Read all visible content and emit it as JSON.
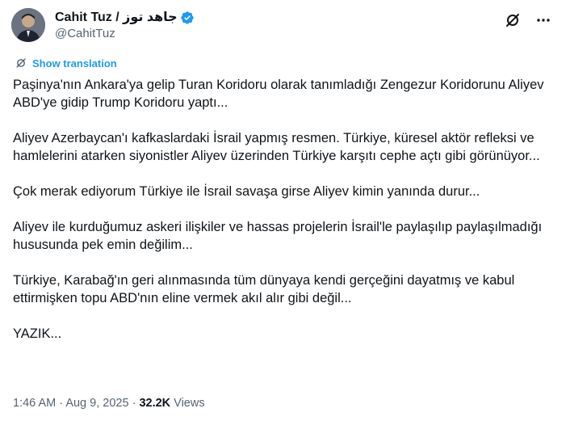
{
  "author": {
    "display_name": "Cahit Tuz / جاهد توز",
    "handle": "@CahitTuz",
    "verified": true
  },
  "translate": {
    "label": "Show translation"
  },
  "tweet": {
    "paragraphs": [
      "Paşinya'nın Ankara'ya gelip Turan Koridoru olarak tanımladığı Zengezur Koridorunu Aliyev ABD'ye gidip Trump Koridoru yaptı...",
      "Aliyev Azerbaycan'ı kafkaslardaki İsrail yapmış resmen. Türkiye, küresel aktör refleksi ve hamlelerini atarken siyonistler Aliyev üzerinden Türkiye karşıtı cephe açtı gibi görünüyor...",
      "Çok merak ediyorum Türkiye ile İsrail savaşa girse Aliyev kimin yanında durur...",
      "Aliyev ile kurduğumuz askeri ilişkiler ve hassas projelerin İsrail'le paylaşılıp paylaşılmadığı hususunda pek emin değilim...",
      "Türkiye, Karabağ'ın geri alınmasında tüm dünyaya kendi gerçeğini dayatmış ve kabul ettirmişken topu ABD'nın eline vermek akıl alır gibi değil...",
      "YAZIK..."
    ]
  },
  "meta": {
    "time": "1:46 AM",
    "date": "Aug 9, 2025",
    "views_count": "32.2K",
    "views_label": "Views",
    "separator": "·"
  },
  "icons": {
    "grok": "grok-slash-icon",
    "more": "more-horizontal-icon",
    "translate": "translate-slash-icon",
    "verified": "verified-badge-icon"
  },
  "colors": {
    "accent": "#1d9bf0",
    "text_primary": "#0f1419",
    "text_secondary": "#536471"
  }
}
